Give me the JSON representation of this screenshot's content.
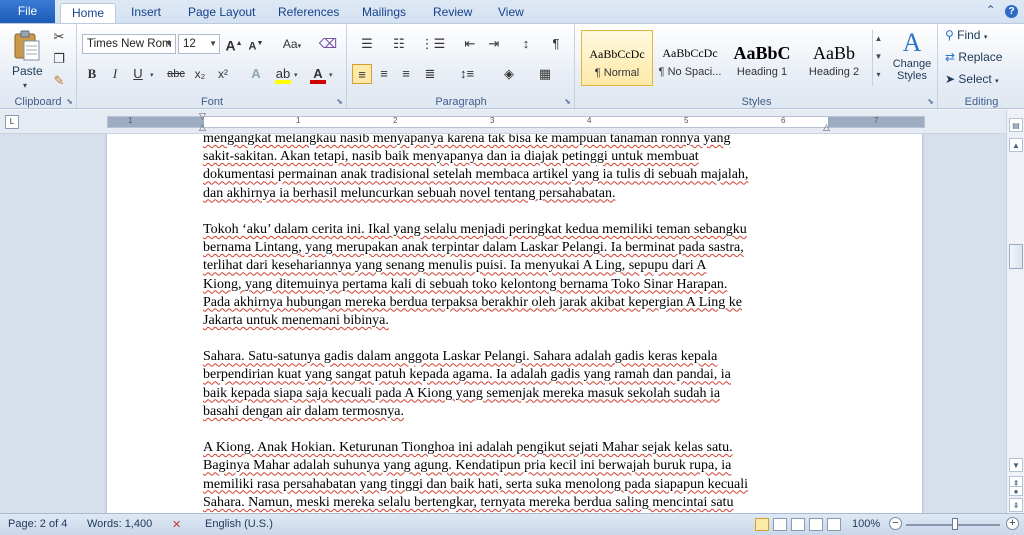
{
  "tabs": {
    "file": "File",
    "items": [
      "Home",
      "Insert",
      "Page Layout",
      "References",
      "Mailings",
      "Review",
      "View"
    ]
  },
  "clipboard": {
    "paste": "Paste",
    "label": "Clipboard"
  },
  "font": {
    "name": "Times New Rom",
    "size": "12",
    "label": "Font",
    "bold": "B",
    "italic": "I",
    "underline": "U",
    "strike": "abc",
    "subscript": "x₂",
    "superscript": "x²",
    "grow": "A",
    "shrink": "A",
    "change_case": "Aa",
    "text_color_hex": "#d00000",
    "highlight_color_hex": "#ffff00"
  },
  "paragraph": {
    "label": "Paragraph",
    "show_marks": "¶"
  },
  "styles": {
    "label": "Styles",
    "items": [
      {
        "preview": "AaBbCcDc",
        "name": "¶ Normal"
      },
      {
        "preview": "AaBbCcDc",
        "name": "¶ No Spaci..."
      },
      {
        "preview": "AaBbC",
        "name": "Heading 1"
      },
      {
        "preview": "AaBb",
        "name": "Heading 2"
      }
    ],
    "change_styles": [
      "Change",
      "Styles"
    ]
  },
  "editing": {
    "label": "Editing",
    "find": "Find",
    "replace": "Replace",
    "select": "Select"
  },
  "ruler": {
    "numbers": [
      "1",
      "1",
      "2",
      "3",
      "4",
      "5",
      "6",
      "7"
    ]
  },
  "document": {
    "lines": [
      "mengangkat melangkau nasib menyapanya karena tak bisa ke mampuan tanaman ronnya yang",
      "sakit-sakitan. Akan tetapi, nasib baik menyapanya dan ia diajak petinggi untuk membuat",
      "dokumentasi permainan anak tradisional setelah membaca artikel yang ia tulis di sebuah majalah,",
      "dan akhirnya ia berhasil meluncurkan  sebuah novel tentang persahabatan.",
      "",
      "Tokoh ‘aku’ dalam cerita ini. Ikal yang selalu menjadi peringkat kedua memiliki  teman sebangku",
      "bernama Lintang, yang merupakan anak terpintar dalam Laskar Pelangi. Ia berminat pada sastra,",
      "terlihat dari kesehariannya  yang senang menulis  puisi. Ia menyukai A Ling, sepupu dari A",
      "Kiong, yang ditemuinya pertama kali di sebuah toko kelontong bernama Toko Sinar Harapan.",
      "Pada akhirnya hubungan mereka berdua terpaksa berakhir oleh jarak akibat kepergian A Ling ke",
      "Jakarta untuk menemani bibinya.",
      "",
      "Sahara. Satu-satunya gadis dalam anggota Laskar Pelangi. Sahara adalah gadis keras kepala",
      "berpendirian kuat yang  sangat patuh kepada agama. Ia adalah gadis yang ramah  dan pandai, ia",
      "baik kepada siapa  saja kecuali pada A Kiong yang semenjak mereka masuk sekolah sudah ia",
      "basahi  dengan air  dalam termosnya.",
      "",
      "A Kiong. Anak Hokian. Keturunan Tionghoa ini adalah pengikut sejati Mahar sejak kelas satu.",
      "Baginya Mahar adalah suhunya yang agung. Kendatipun pria kecil ini  berwajah buruk rupa, ia",
      "memiliki  rasa persahabatan yang tinggi  dan baik hati, serta suka menolong pada siapapun kecuali",
      "Sahara. Namun, meski mereka selalu bertengkar, ternyata mereka berdua saling mencintai  satu"
    ]
  },
  "status": {
    "page": "Page: 2 of 4",
    "words": "Words: 1,400",
    "language": "English (U.S.)",
    "zoom": "100%",
    "zoom_minus": "−",
    "zoom_plus": "+"
  }
}
